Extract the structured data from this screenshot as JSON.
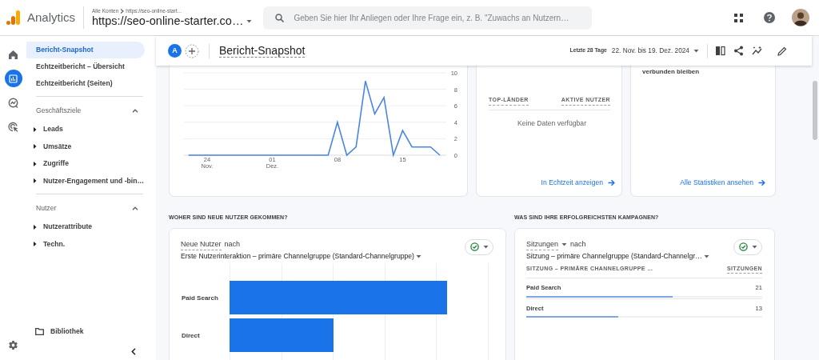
{
  "app": {
    "name": "Analytics"
  },
  "account": {
    "breadcrumb": "Alle Konten",
    "breadcrumb_child": "https://seo-online-start…",
    "property": "https://seo-online-starter.co…"
  },
  "search": {
    "placeholder": "Geben Sie hier Ihr Anliegen oder Ihre Frage ein, z. B. \"Zuwachs an Nutzern…"
  },
  "rail": [
    {
      "kind": "home",
      "selected": false
    },
    {
      "kind": "reports",
      "selected": true
    },
    {
      "kind": "explore",
      "selected": false
    },
    {
      "kind": "advertising",
      "selected": false
    }
  ],
  "sidebar": {
    "items": [
      {
        "label": "Bericht-Snapshot",
        "selected": true
      },
      {
        "label": "Echtzeitbericht – Übersicht",
        "selected": false
      },
      {
        "label": "Echtzeitbericht (Seiten)",
        "selected": false
      }
    ],
    "sections": [
      {
        "title": "Geschäftsziele",
        "expanded": true,
        "children": [
          {
            "label": "Leads",
            "expanded": false
          },
          {
            "label": "Umsätze",
            "expanded": false
          },
          {
            "label": "Zugriffe",
            "expanded": false
          },
          {
            "label": "Nutzer-Engagement und -bin…",
            "expanded": false
          }
        ]
      },
      {
        "title": "Nutzer",
        "expanded": true,
        "children": [
          {
            "label": "Nutzerattribute",
            "expanded": false
          },
          {
            "label": "Techn.",
            "expanded": false
          }
        ]
      }
    ],
    "library": "Bibliothek"
  },
  "header": {
    "comparison_letter": "A",
    "title": "Bericht-Snapshot",
    "range_label": "Letzte 28 Tage",
    "date_range": "22. Nov. bis 19. Dez. 2024"
  },
  "realtime_chart": {
    "chart_data": {
      "type": "line",
      "categories": [
        null,
        null,
        "24 Nov.",
        null,
        null,
        null,
        null,
        null,
        null,
        "01 Dez.",
        null,
        null,
        null,
        null,
        null,
        null,
        "08",
        null,
        null,
        null,
        null,
        null,
        null,
        "15",
        null,
        null,
        null,
        null
      ],
      "ylim": [
        0,
        10
      ],
      "grid": true,
      "yticks": [
        0,
        2,
        4,
        6,
        8,
        10
      ],
      "series": [
        {
          "color": "#4a86e0",
          "values": [
            0,
            0,
            0,
            0,
            0,
            0,
            0,
            0,
            0,
            0,
            0,
            0,
            0,
            0,
            0,
            0,
            4,
            0,
            1,
            9,
            5,
            7,
            0,
            3,
            1,
            1,
            1,
            0
          ]
        }
      ]
    }
  },
  "countries_card": {
    "columns": [
      "TOP-LÄNDER",
      "AKTIVE NUTZER"
    ],
    "empty_text": "Keine Daten verfügbar",
    "link": "In Echtzeit anzeigen"
  },
  "insights_card": {
    "text": "verbunden bleiben",
    "link": "Alle Statistiken ansehen"
  },
  "new_users": {
    "heading": "WOHER SIND NEUE NUTZER GEKOMMEN?",
    "metric": "Neue Nutzer",
    "connector": "nach",
    "dimension": "Erste Nutzerinteraktion – primäre Channelgruppe (Standard-Channelgruppe)",
    "bars": [
      {
        "label": "Paid Search",
        "level": 0.84
      },
      {
        "label": "Direct",
        "level": 0.4
      }
    ]
  },
  "campaigns": {
    "heading": "WAS SIND IHRE ERFOLGREICHSTEN KAMPAGNEN?",
    "metric": "Sitzungen",
    "connector": "nach",
    "dimension": "Sitzung – primäre Channelgruppe (Standard-Channelgr…",
    "columns": [
      "SITZUNG – PRIMÄRE CHANNELGRUPPE …",
      "SITZUNGEN"
    ],
    "rows": [
      {
        "label": "Paid Search",
        "value": "21",
        "level": 0.62
      },
      {
        "label": "Direct",
        "value": "13",
        "level": 0.39
      }
    ]
  }
}
